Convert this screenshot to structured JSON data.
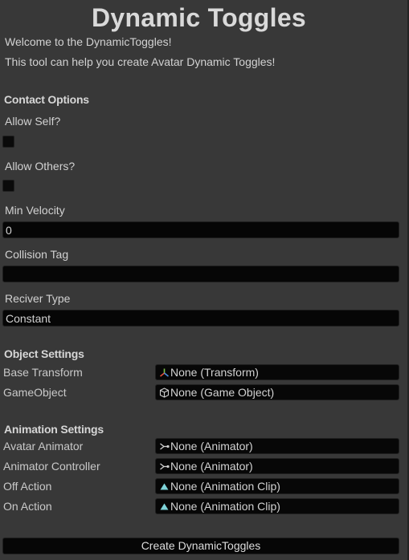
{
  "title": "Dynamic Toggles",
  "intro": {
    "line1": "Welcome to the DynamicToggles!",
    "line2": "This tool can help you create Avatar Dynamic Toggles!"
  },
  "contact": {
    "header": "Contact Options",
    "allow_self_label": "Allow Self?",
    "allow_self_checked": false,
    "allow_others_label": "Allow Others?",
    "allow_others_checked": false,
    "min_velocity_label": "Min Velocity",
    "min_velocity_value": "0",
    "collision_tag_label": "Collision Tag",
    "collision_tag_value": "",
    "receiver_type_label": "Reciver Type",
    "receiver_type_value": "Constant"
  },
  "object_settings": {
    "header": "Object Settings",
    "base_transform_label": "Base Transform",
    "base_transform_value": "None (Transform)",
    "base_transform_icon": "transform-icon",
    "gameobject_label": "GameObject",
    "gameobject_value": "None (Game Object)",
    "gameobject_icon": "gameobject-cube-icon"
  },
  "animation_settings": {
    "header": "Animation Settings",
    "avatar_animator_label": "Avatar Animator",
    "avatar_animator_value": "None (Animator)",
    "animator_controller_label": "Animator Controller",
    "animator_controller_value": "None (Animator)",
    "animator_icon": "animator-icon",
    "off_action_label": "Off Action",
    "off_action_value": "None (Animation Clip)",
    "on_action_label": "On Action",
    "on_action_value": "None (Animation Clip)",
    "clip_icon": "animation-clip-icon"
  },
  "create_button_label": "Create DynamicToggles",
  "colors": {
    "background": "#383838",
    "field": "#060606",
    "text": "#d2d2d2",
    "clip_icon": "#7ed3d8",
    "transform_x": "#e0523c",
    "transform_y": "#7fc24a",
    "transform_z": "#4a8de0"
  }
}
